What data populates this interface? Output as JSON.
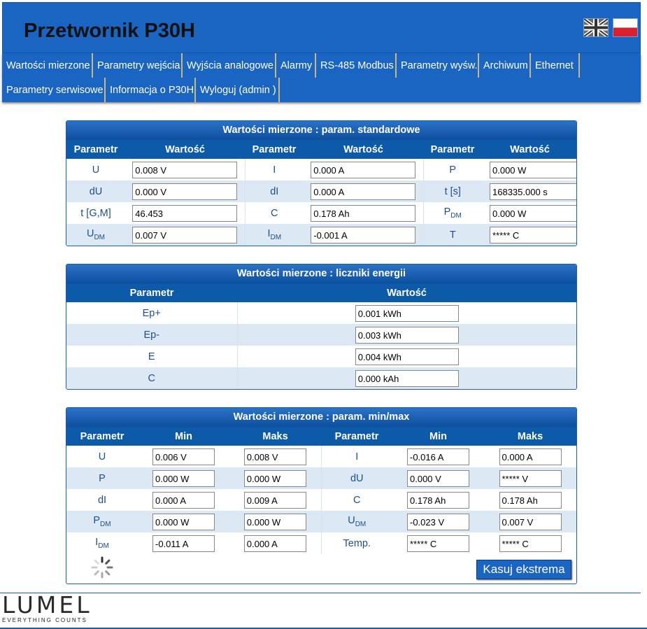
{
  "header": {
    "title": "Przetwornik P30H"
  },
  "nav": [
    "Wartości mierzone",
    "Parametry wejścia",
    "Wyjścia analogowe",
    "Alarmy",
    "RS-485 Modbus",
    "Parametry wyśw.",
    "Archiwum",
    "Ethernet",
    "Parametry serwisowe",
    "Informacja o P30H",
    "Wyloguj (admin )"
  ],
  "standard": {
    "title": "Wartości mierzone : param. standardowe",
    "headers": [
      "Parametr",
      "Wartość",
      "Parametr",
      "Wartość",
      "Parametr",
      "Wartość"
    ],
    "rows": [
      {
        "p1": "U",
        "v1": "0.008 V",
        "p2": "I",
        "v2": "0.000 A",
        "p3": "P",
        "v3": "0.000 W"
      },
      {
        "p1": "dU",
        "v1": "0.000 V",
        "p2": "dI",
        "v2": "0.000 A",
        "p3": "t [s]",
        "v3": "168335.000 s"
      },
      {
        "p1": "t [G,M]",
        "v1": "46.453",
        "p2": "C",
        "v2": "0.178 Ah",
        "p3": "P",
        "p3_sub": "DM",
        "v3": "0.000 W"
      },
      {
        "p1": "U",
        "p1_sub": "DM",
        "v1": "0.007 V",
        "p2": "I",
        "p2_sub": "DM",
        "v2": "-0.001 A",
        "p3": "T",
        "v3": "***** C"
      }
    ]
  },
  "energy": {
    "title": "Wartości mierzone : liczniki energii",
    "headers": [
      "Parametr",
      "Wartość"
    ],
    "rows": [
      {
        "p": "Ep+",
        "v": "0.001 kWh"
      },
      {
        "p": "Ep-",
        "v": "0.003 kWh"
      },
      {
        "p": "E",
        "v": "0.004 kWh"
      },
      {
        "p": "C",
        "v": "0.000 kAh"
      }
    ]
  },
  "minmax": {
    "title": "Wartości mierzone : param. min/max",
    "headers": [
      "Parametr",
      "Min",
      "Maks",
      "Parametr",
      "Min",
      "Maks"
    ],
    "rows": [
      {
        "p1": "U",
        "min1": "0.006 V",
        "max1": "0.008 V",
        "p2": "I",
        "min2": "-0.016 A",
        "max2": "0.000 A"
      },
      {
        "p1": "P",
        "min1": "0.000 W",
        "max1": "0.000 W",
        "p2": "dU",
        "min2": "0.000 V",
        "max2": "***** V"
      },
      {
        "p1": "dI",
        "min1": "0.000 A",
        "max1": "0.009 A",
        "p2": "C",
        "min2": "0.178 Ah",
        "max2": "0.178 Ah"
      },
      {
        "p1": "P",
        "p1_sub": "DM",
        "min1": "0.000 W",
        "max1": "0.000 W",
        "p2": "U",
        "p2_sub": "DM",
        "min2": "-0.023 V",
        "max2": "0.007 V"
      },
      {
        "p1": "I",
        "p1_sub": "DM",
        "min1": "-0.011 A",
        "max1": "0.000 A",
        "p2": "Temp.",
        "min2": "***** C",
        "max2": "***** C"
      }
    ],
    "reset_label": "Kasuj ekstrema"
  },
  "footer": {
    "logo_word": "LUMEL",
    "logo_tagline": "EVERYTHING COUNTS"
  },
  "icons": {
    "flag_en": "uk-flag-icon",
    "flag_pl": "pl-flag-icon",
    "spinner": "loading-spinner-icon"
  },
  "colors": {
    "header_bg": "#1a64c2",
    "table_header": "#0d5aa8",
    "alt_row": "#dce9f4",
    "text": "#1f4f8a"
  }
}
